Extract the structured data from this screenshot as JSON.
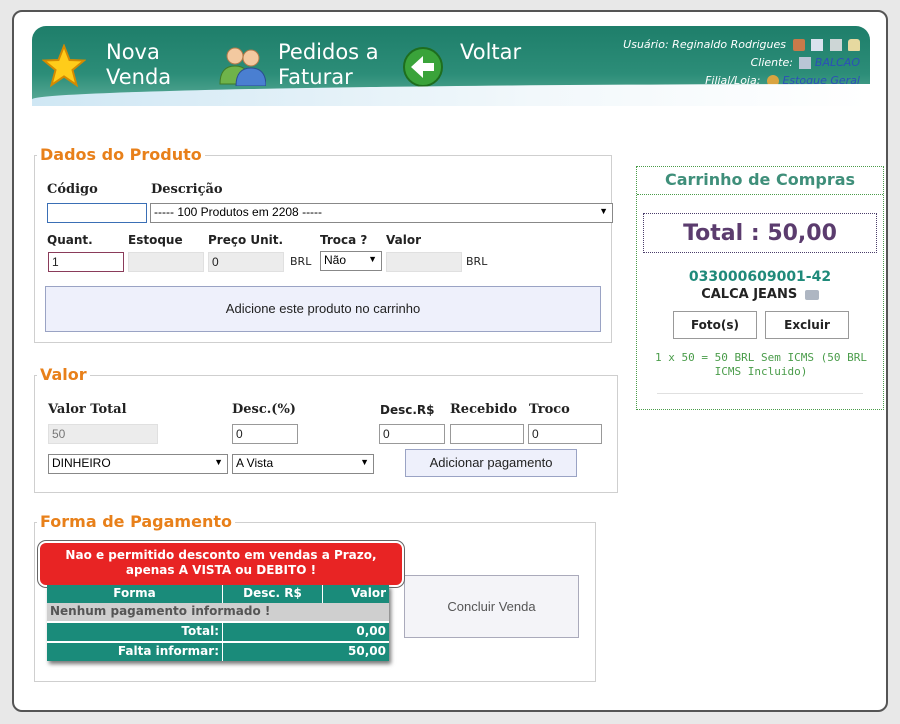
{
  "header": {
    "nav": [
      {
        "line1": "Nova",
        "line2": "Venda",
        "icon": "star-icon"
      },
      {
        "line1": "Pedidos a",
        "line2": "Faturar",
        "icon": "users-icon"
      },
      {
        "line1": "Voltar",
        "line2": "",
        "icon": "back-arrow-icon"
      }
    ],
    "user_label": "Usuário:",
    "user_name": "Reginaldo Rodrigues",
    "client_label": "Cliente:",
    "client_value": "BALCAO",
    "store_label": "Filial/Loja:",
    "store_value": "Estoque Geral"
  },
  "produto": {
    "legend": "Dados do Produto",
    "codigo_label": "Código",
    "codigo_value": "",
    "descricao_label": "Descrição",
    "descricao_value": "----- 100 Produtos em 2208 -----",
    "quant_label": "Quant.",
    "quant_value": "1",
    "estoque_label": "Estoque",
    "estoque_value": "",
    "preco_label": "Preço Unit.",
    "preco_value": "0",
    "currency": "BRL",
    "troca_label": "Troca ?",
    "troca_value": "Não",
    "valor_label": "Valor",
    "valor_value": "",
    "add_button": "Adicione este produto no carrinho"
  },
  "valor": {
    "legend": "Valor",
    "total_label": "Valor Total",
    "total_value": "50",
    "desc_pct_label": "Desc.(%)",
    "desc_pct_value": "0",
    "desc_rs_label": "Desc.R$",
    "desc_rs_value": "0",
    "recebido_label": "Recebido",
    "recebido_value": "",
    "troco_label": "Troco",
    "troco_value": "0",
    "forma_value": "DINHEIRO",
    "condicao_value": "A Vista",
    "add_pag_button": "Adicionar pagamento"
  },
  "pagamento": {
    "legend": "Forma de Pagamento",
    "error_line1": "Nao e permitido desconto em vendas a Prazo,",
    "error_line2": "apenas A VISTA ou DEBITO !",
    "col_forma": "Forma",
    "col_desc": "Desc. R$",
    "col_valor": "Valor",
    "empty_msg": "Nenhum pagamento informado !",
    "total_label": "Total:",
    "total_value": "0,00",
    "falta_label": "Falta informar:",
    "falta_value": "50,00",
    "concluir_button": "Concluir Venda"
  },
  "carrinho": {
    "title": "Carrinho de Compras",
    "total_label": "Total :",
    "total_value": "50,00",
    "item_code": "033000609001-42",
    "item_name": "CALCA JEANS",
    "foto_button": "Foto(s)",
    "excluir_button": "Excluir",
    "item_calc": "1 x 50 = 50 BRL Sem ICMS (50 BRL ICMS Incluido)"
  }
}
